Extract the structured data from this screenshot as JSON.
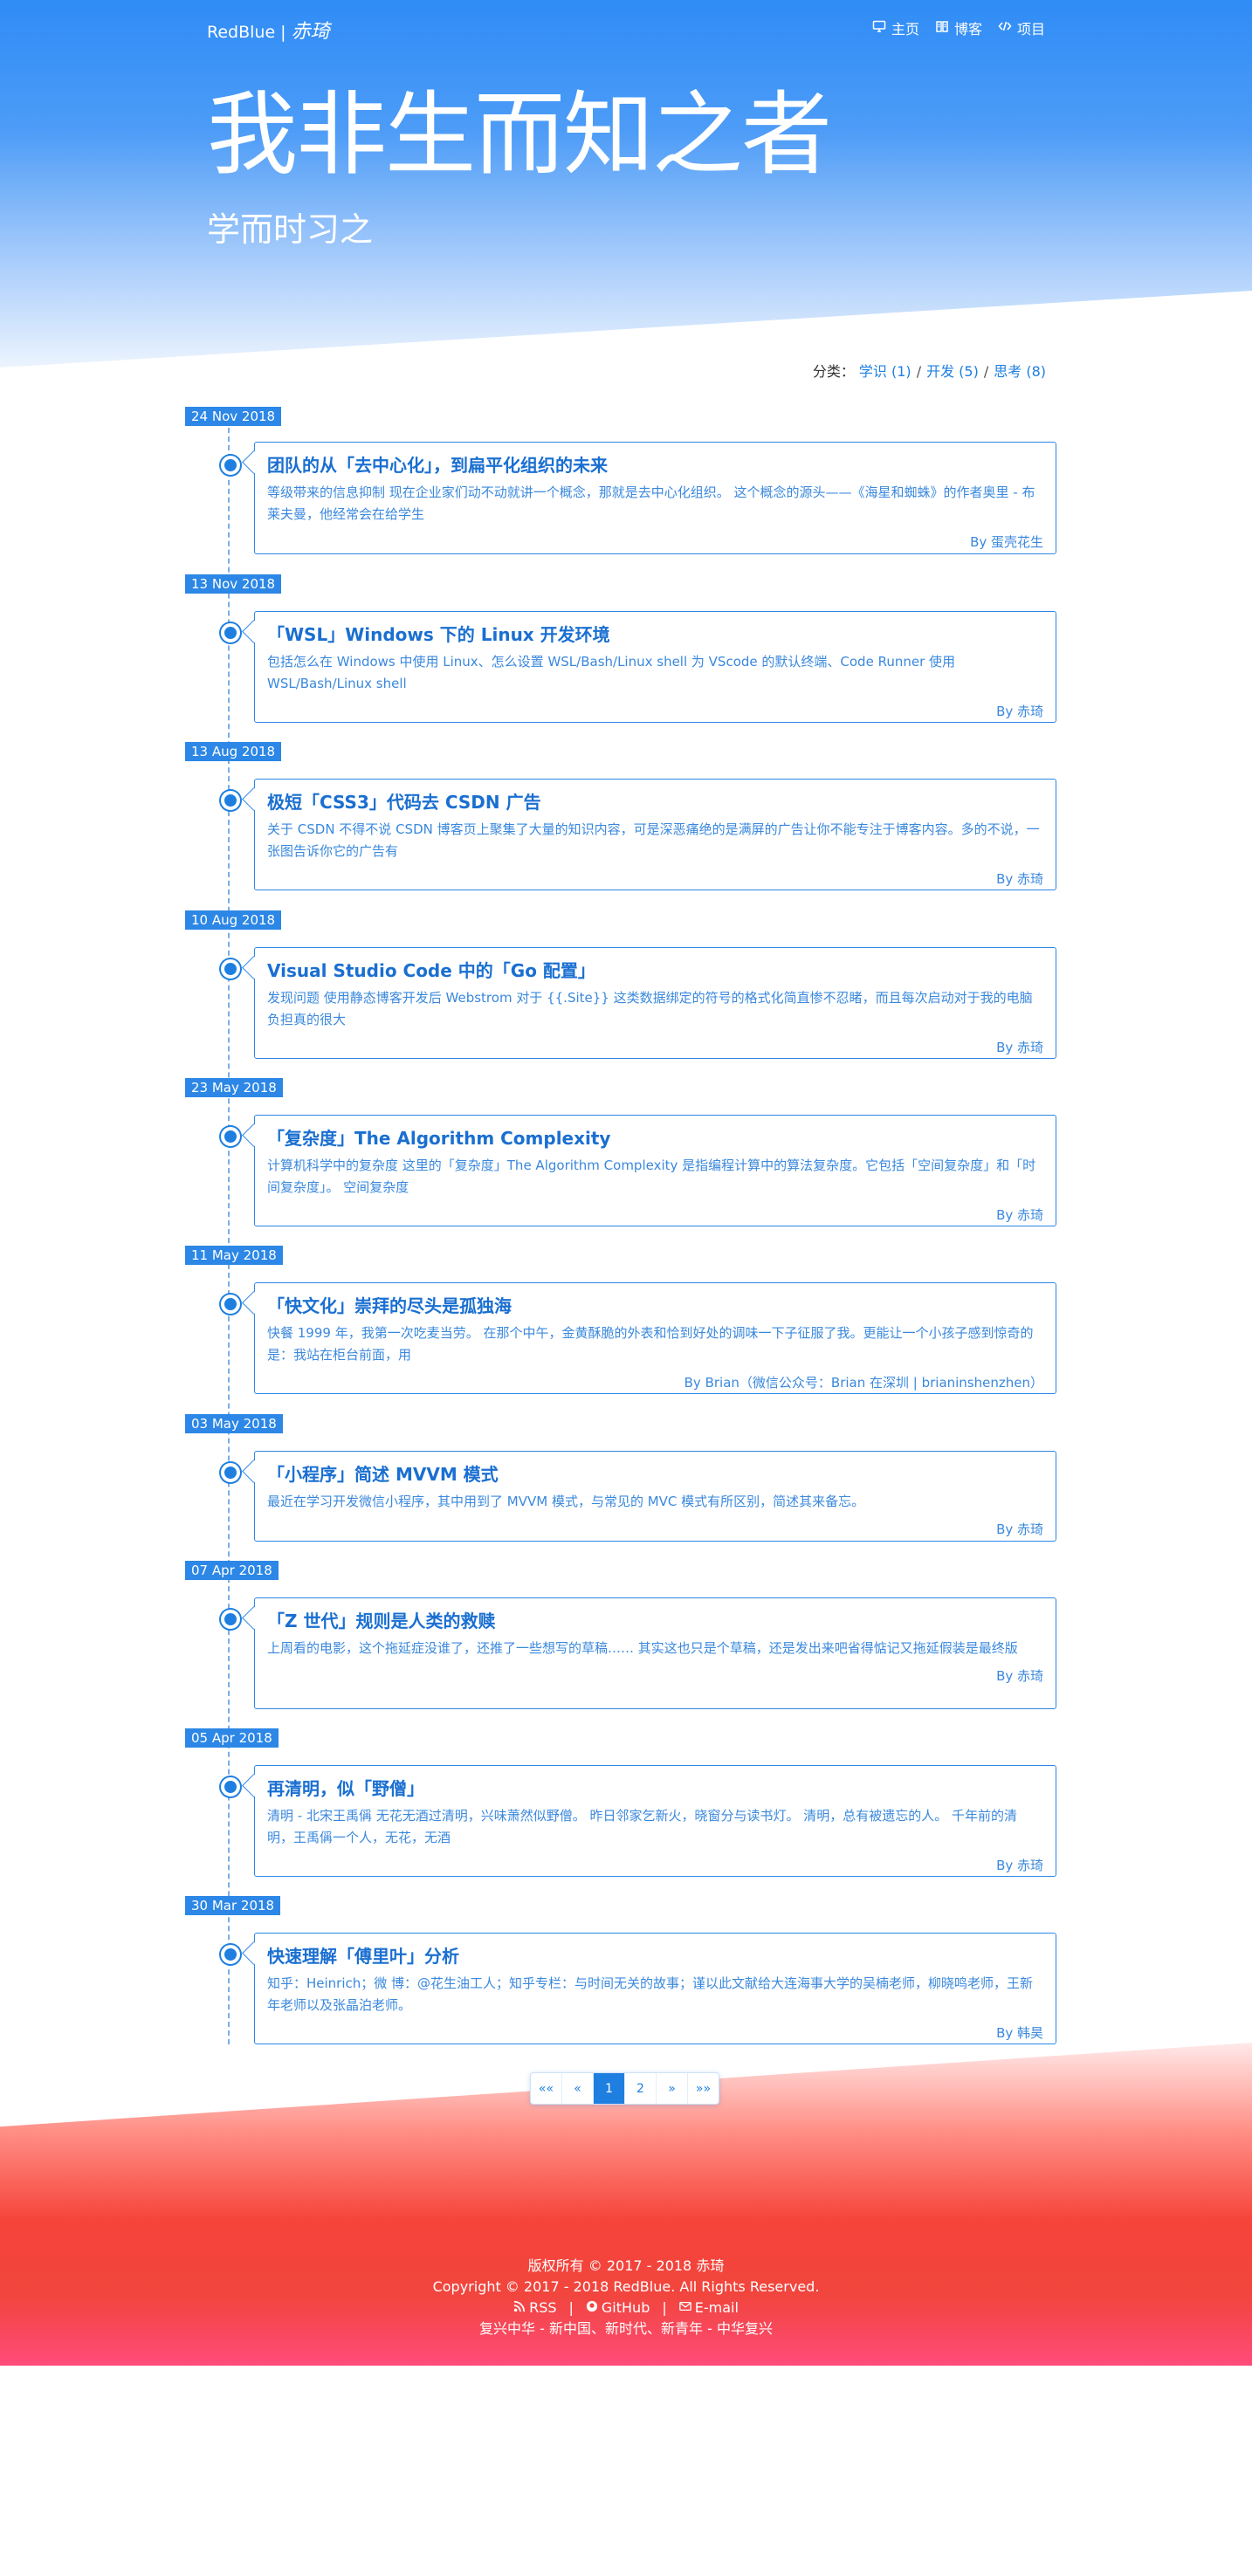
{
  "nav": {
    "brand": "RedBlue",
    "brand_sep": "|",
    "brand_sig": "赤琦",
    "links": [
      {
        "label": "主页",
        "icon": "monitor-icon"
      },
      {
        "label": "博客",
        "icon": "book-icon"
      },
      {
        "label": "项目",
        "icon": "code-icon"
      }
    ]
  },
  "hero": {
    "title": "我非生而知之者",
    "subtitle": "学而时习之"
  },
  "categories": {
    "label": "分类：",
    "items": [
      "学识 (1)",
      "开发 (5)",
      "思考 (8)"
    ]
  },
  "posts": [
    {
      "date": "24 Nov 2018",
      "title": "团队的从「去中心化」，到扁平化组织的未来",
      "excerpt": "等级带来的信息抑制 现在企业家们动不动就讲一个概念，那就是去中心化组织。 这个概念的源头——《海星和蜘蛛》的作者奥里 - 布莱夫曼，他经常会在给学生",
      "author": "By 蛋壳花生"
    },
    {
      "date": "13 Nov 2018",
      "title": "「WSL」Windows 下的 Linux 开发环境",
      "excerpt": "包括怎么在 Windows 中使用 Linux、怎么设置 WSL/Bash/Linux shell 为 VScode 的默认终端、Code Runner 使用 WSL/Bash/Linux shell",
      "author": "By 赤琦"
    },
    {
      "date": "13 Aug 2018",
      "title": "极短「CSS3」代码去 CSDN 广告",
      "excerpt": "关于 CSDN 不得不说 CSDN 博客页上聚集了大量的知识内容，可是深恶痛绝的是满屏的广告让你不能专注于博客内容。多的不说，一张图告诉你它的广告有",
      "author": "By 赤琦"
    },
    {
      "date": "10 Aug 2018",
      "title": "Visual Studio Code 中的「Go 配置」",
      "excerpt": "发现问题 使用静态博客开发后 Webstrom 对于 {{.Site}} 这类数据绑定的符号的格式化简直惨不忍睹，而且每次启动对于我的电脑负担真的很大",
      "author": "By 赤琦"
    },
    {
      "date": "23 May 2018",
      "title": "「复杂度」The Algorithm Complexity",
      "excerpt": "计算机科学中的复杂度 这里的「复杂度」The Algorithm Complexity 是指编程计算中的算法复杂度。它包括「空间复杂度」和「时间复杂度」。 空间复杂度",
      "author": "By 赤琦"
    },
    {
      "date": "11 May 2018",
      "title": "「快文化」崇拜的尽头是孤独海",
      "excerpt": "快餐 1999 年，我第一次吃麦当劳。 在那个中午，金黄酥脆的外表和恰到好处的调味一下子征服了我。更能让一个小孩子感到惊奇的是：我站在柜台前面，用",
      "author": "By Brian（微信公众号：Brian 在深圳 | brianinshenzhen）"
    },
    {
      "date": "03 May 2018",
      "title": "「小程序」简述 MVVM 模式",
      "excerpt": "最近在学习开发微信小程序，其中用到了 MVVM 模式，与常见的 MVC 模式有所区别，简述其来备忘。",
      "author": "By 赤琦"
    },
    {
      "date": "07 Apr 2018",
      "title": "「Z 世代」规则是人类的救赎",
      "excerpt": "上周看的电影，这个拖延症没谁了，还推了一些想写的草稿…… 其实这也只是个草稿，还是发出来吧省得惦记又拖延假装是最终版",
      "author": "By 赤琦"
    },
    {
      "date": "05 Apr 2018",
      "title": "再清明，似「野僧」",
      "excerpt": "清明 - 北宋王禹偁 无花无酒过清明，兴味萧然似野僧。 昨日邻家乞新火，晓窗分与读书灯。 清明，总有被遗忘的人。 千年前的清明，王禹偁一个人，无花，无酒",
      "author": "By 赤琦"
    },
    {
      "date": "30 Mar 2018",
      "title": "快速理解「傅里叶」分析",
      "excerpt": "知乎：Heinrich；微 博：@花生油工人；知乎专栏：与时间无关的故事；谨以此文献给大连海事大学的吴楠老师，柳晓鸣老师，王新年老师以及张晶泊老师。",
      "author": "By 韩昊"
    }
  ],
  "pagination": {
    "items": [
      "««",
      "«",
      "1",
      "2",
      "»",
      "»»"
    ],
    "current": "1"
  },
  "footer": {
    "copyright_cn": "版权所有 © 2017 - 2018 赤琦",
    "copyright_en": "Copyright © 2017 - 2018 RedBlue. All Rights Reserved.",
    "links": [
      {
        "label": "RSS",
        "icon": "rss-icon"
      },
      {
        "label": "GitHub",
        "icon": "github-icon"
      },
      {
        "label": "E-mail",
        "icon": "mail-icon"
      }
    ],
    "slogan": "复兴中华 - 新中国、新时代、新青年 - 中华复兴"
  },
  "colors": {
    "accent": "#1e7fe0",
    "hero_top": "#2f8cf6",
    "footer_red": "#f1453d",
    "footer_pink": "#ff4b7a"
  }
}
